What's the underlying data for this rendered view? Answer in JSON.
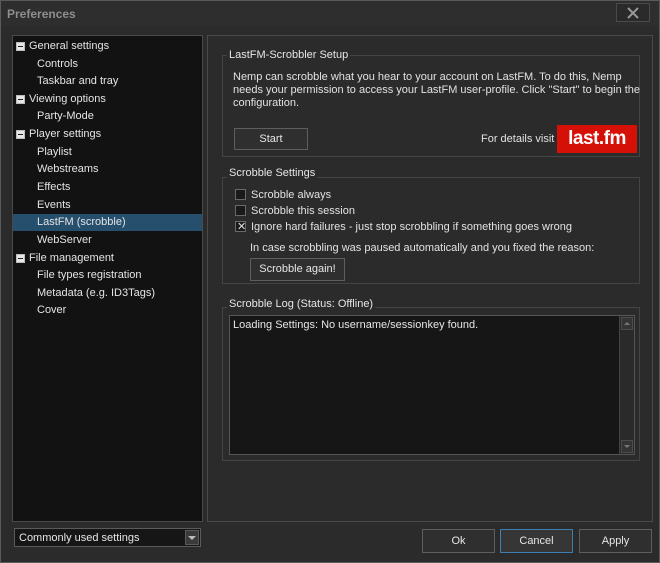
{
  "window": {
    "title": "Preferences"
  },
  "tree": {
    "items": [
      {
        "label": "General settings",
        "level": 0,
        "expander": true
      },
      {
        "label": "Controls",
        "level": 1
      },
      {
        "label": "Taskbar and tray",
        "level": 1
      },
      {
        "label": "Viewing options",
        "level": 0,
        "expander": true
      },
      {
        "label": "Party-Mode",
        "level": 1
      },
      {
        "label": "Player settings",
        "level": 0,
        "expander": true
      },
      {
        "label": "Playlist",
        "level": 1
      },
      {
        "label": "Webstreams",
        "level": 1
      },
      {
        "label": "Effects",
        "level": 1
      },
      {
        "label": "Events",
        "level": 1
      },
      {
        "label": "LastFM (scrobble)",
        "level": 1,
        "selected": true
      },
      {
        "label": "WebServer",
        "level": 1
      },
      {
        "label": "File management",
        "level": 0,
        "expander": true
      },
      {
        "label": "File types registration",
        "level": 1
      },
      {
        "label": "Metadata (e.g. ID3Tags)",
        "level": 1
      },
      {
        "label": "Cover",
        "level": 1
      }
    ]
  },
  "combo": {
    "value": "Commonly used settings"
  },
  "setup": {
    "title": "LastFM-Scrobbler Setup",
    "line1": "Nemp can scrobble what you hear to your account on LastFM. To do this, Nemp",
    "line2": "needs your permission to access your LastFM user-profile. Click \"Start\" to begin the",
    "line3": "configuration.",
    "start_label": "Start",
    "details_label": "For details visit",
    "logo_text": "last.fm"
  },
  "scrobble": {
    "title": "Scrobble Settings",
    "always_label": "Scrobble always",
    "session_label": "Scrobble this session",
    "ignore_label": "Ignore hard failures - just stop scrobbling if something goes wrong",
    "paused_text": "In case scrobbling was paused automatically and you fixed the reason:",
    "again_label": "Scrobble again!"
  },
  "log": {
    "title": "Scrobble Log (Status: Offline)",
    "text": "Loading Settings: No username/sessionkey found."
  },
  "buttons": {
    "ok": "Ok",
    "cancel": "Cancel",
    "apply": "Apply"
  },
  "colors": {
    "selected": "#264f6e",
    "lastfm_red": "#d51007",
    "focus_border": "#3d7fb3"
  }
}
